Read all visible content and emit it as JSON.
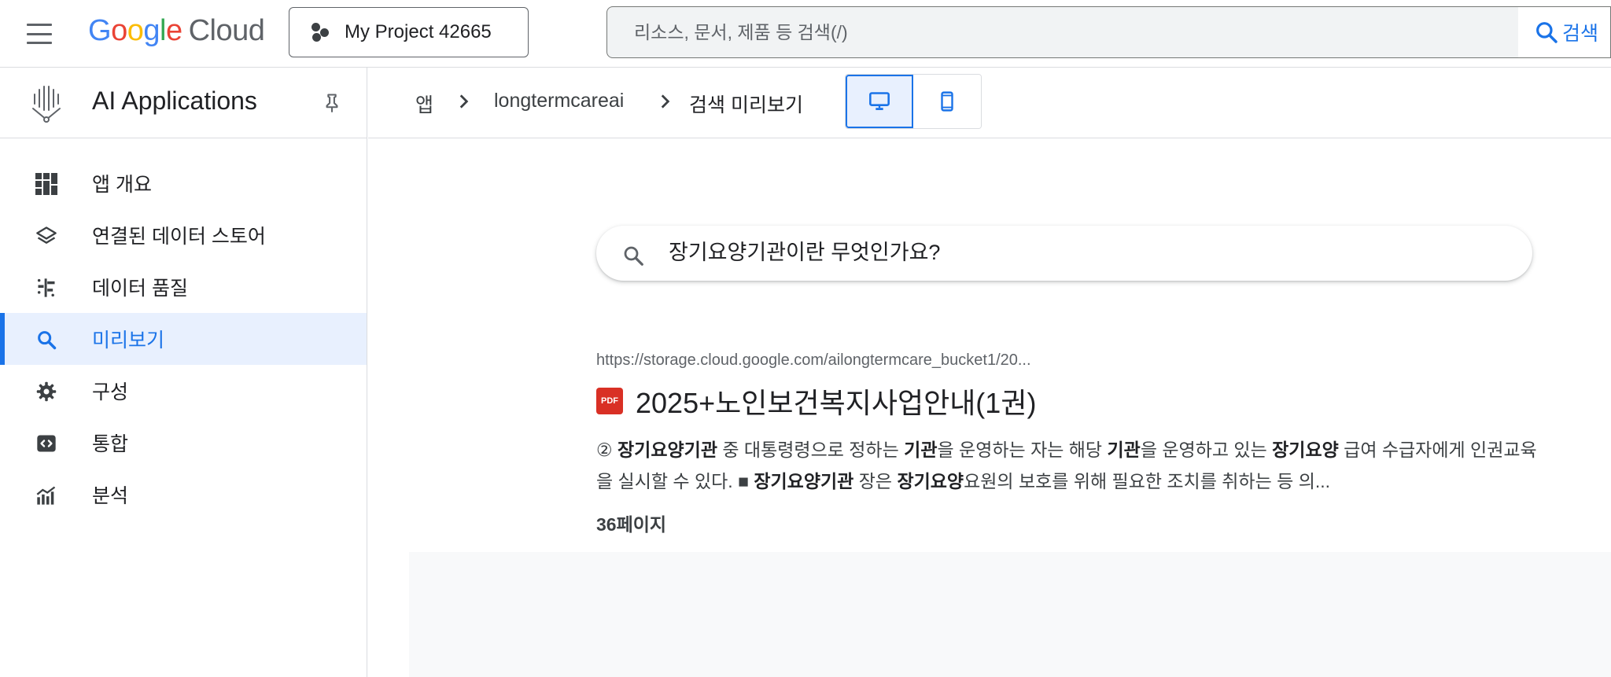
{
  "topbar": {
    "logo_word": "Google",
    "logo_cloud": "Cloud",
    "project_label": "My Project 42665",
    "search_placeholder": "리소스, 문서, 제품 등 검색(/)",
    "search_button": "검색"
  },
  "sidebar": {
    "app_title": "AI Applications",
    "items": [
      {
        "label": "앱 개요",
        "icon": "dashboard-icon"
      },
      {
        "label": "연결된 데이터 스토어",
        "icon": "layers-icon"
      },
      {
        "label": "데이터 품질",
        "icon": "data-quality-icon"
      },
      {
        "label": "미리보기",
        "icon": "search-icon",
        "active": true
      },
      {
        "label": "구성",
        "icon": "gear-icon"
      },
      {
        "label": "통합",
        "icon": "code-icon"
      },
      {
        "label": "분석",
        "icon": "analytics-icon"
      }
    ]
  },
  "breadcrumb": {
    "items": [
      "앱",
      "longtermcareai",
      "검색 미리보기"
    ]
  },
  "device_toggle": {
    "selected": "desktop"
  },
  "preview": {
    "query": "장기요양기관이란 무엇인가요?",
    "result": {
      "url": "https://storage.cloud.google.com/ailongtermcare_bucket1/20...",
      "file_type": "PDF",
      "title": "2025+노인보건복지사업안내(1권)",
      "snippet": [
        {
          "text": "② ",
          "bold": false
        },
        {
          "text": "장기요양기관",
          "bold": true
        },
        {
          "text": " 중 대통령령으로 정하는 ",
          "bold": false
        },
        {
          "text": "기관",
          "bold": true
        },
        {
          "text": "을 운영하는 자는 해당 ",
          "bold": false
        },
        {
          "text": "기관",
          "bold": true
        },
        {
          "text": "을 운영하고 있는 ",
          "bold": false
        },
        {
          "text": "장기요양",
          "bold": true
        },
        {
          "text": " 급여 수급자에게 인권교육을 실시할 수 있다. ■ ",
          "bold": false
        },
        {
          "text": "장기요양기관",
          "bold": true
        },
        {
          "text": " 장은 ",
          "bold": false
        },
        {
          "text": "장기요양",
          "bold": true
        },
        {
          "text": "요원의 보호를 위해 필요한 조치를 취하는 등 의...",
          "bold": false
        }
      ],
      "page": "36페이지"
    }
  },
  "colors": {
    "accent": "#1a73e8",
    "active_bg": "#e8f0fe",
    "pdf_red": "#d93025"
  }
}
